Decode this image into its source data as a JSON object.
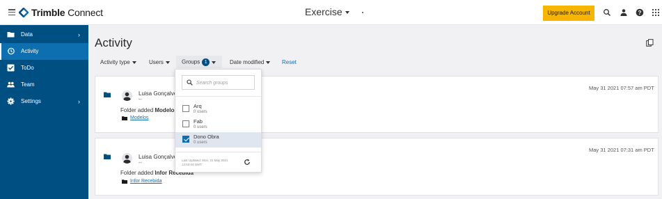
{
  "header": {
    "brand_bold": "Trimble",
    "brand_rest": " Connect",
    "project_name": "Exercise",
    "upgrade_label": "Upgrade Account"
  },
  "sidebar": {
    "items": [
      {
        "label": "Data",
        "icon": "folder-icon",
        "active": false,
        "chevron": "›"
      },
      {
        "label": "Activity",
        "icon": "history-icon",
        "active": true
      },
      {
        "label": "ToDo",
        "icon": "checkbox-icon",
        "active": false
      },
      {
        "label": "Team",
        "icon": "team-icon",
        "active": false
      },
      {
        "label": "Settings",
        "icon": "gear-icon",
        "active": false,
        "chevron": "›"
      }
    ]
  },
  "main": {
    "title": "Activity",
    "filters": {
      "activity_type": "Activity type",
      "users": "Users",
      "groups": "Groups",
      "groups_count": "1",
      "date_modified": "Date modified",
      "reset": "Reset"
    },
    "activities": [
      {
        "user": "Luisa Gonçalves",
        "sub": "--",
        "action_prefix": "Folder added ",
        "target": "Modelos",
        "link": "Modelos",
        "time": "May 31 2021 07:57 am PDT"
      },
      {
        "user": "Luisa Gonçalves",
        "sub": "--",
        "action_prefix": "Folder added ",
        "target": "Infor Recebida",
        "link": "Infor Recebida",
        "time": "May 31 2021 07:31 am PDT"
      }
    ]
  },
  "groups_dropdown": {
    "search_placeholder": "Search groups",
    "groups": [
      {
        "name": "Arq",
        "users": "0 users",
        "checked": false
      },
      {
        "name": "Fab",
        "users": "0 users",
        "checked": false
      },
      {
        "name": "Dono Obra",
        "users": "0 users",
        "checked": true
      }
    ],
    "last_updated": "Last Updated: Mon, 31 May 2021 14:53:04 GMT"
  },
  "colors": {
    "sidebar": "#004f83",
    "sidebar_active": "#0e6fb0",
    "upgrade": "#f7b500",
    "link": "#0e6fb0"
  }
}
